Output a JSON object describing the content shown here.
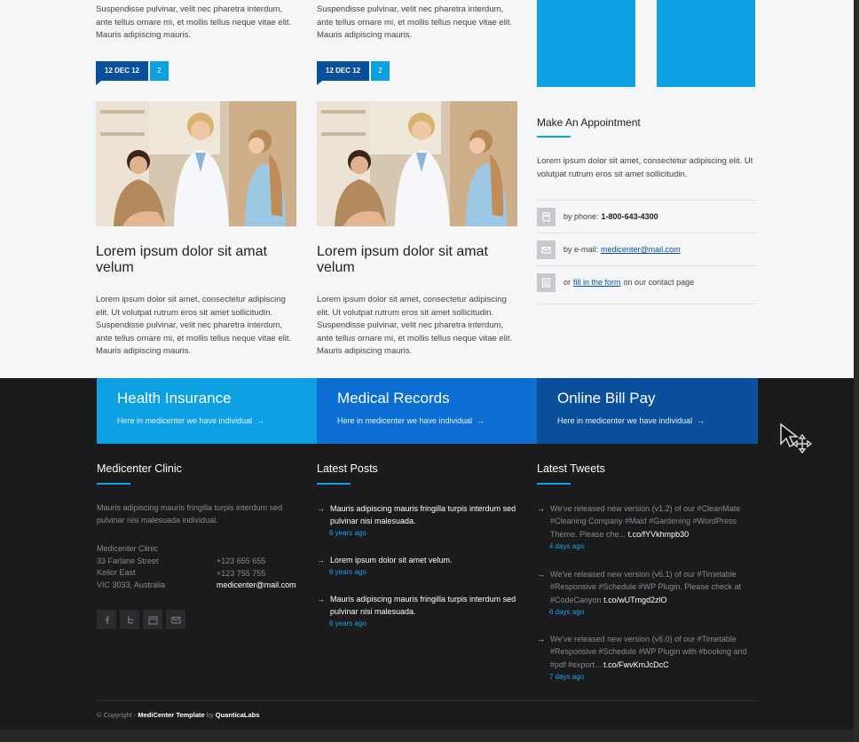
{
  "posts": [
    {
      "top_excerpt": "Suspendisse pulvinar, velit nec pharetra interdum, ante tellus ornare mi, et mollis tellus neque vitae elit. Mauris adipiscing mauris.",
      "date": "12 DEC 12",
      "comments": "2",
      "title": "Lorem ipsum dolor sit amat velum",
      "excerpt": "Lorem ipsum dolor sit amet, consectetur adipiscing elit. Ut volutpat rutrum eros sit amet sollicitudin. Suspendisse pulvinar, velit nec pharetra interdum, ante tellus ornare mi, et mollis tellus neque vitae elit. Mauris adipiscing mauris."
    },
    {
      "top_excerpt": "Suspendisse pulvinar, velit nec pharetra interdum, ante tellus ornare mi, et mollis tellus neque vitae elit. Mauris adipiscing mauris.",
      "date": "12 DEC 12",
      "comments": "2",
      "title": "Lorem ipsum dolor sit amat velum",
      "excerpt": "Lorem ipsum dolor sit amet, consectetur adipiscing elit. Ut volutpat rutrum eros sit amet sollicitudin. Suspendisse pulvinar, velit nec pharetra interdum, ante tellus ornare mi, et mollis tellus neque vitae elit. Mauris adipiscing mauris."
    }
  ],
  "appointment": {
    "title": "Make An Appointment",
    "description": "Lorem ipsum dolor sit amet, consectetur adipiscing elit. Ut volutpat rutrum eros sit amet sollicitudin.",
    "phone_prefix": "by phone:",
    "phone": "1-800-643-4300",
    "email_prefix": "by e-mail:",
    "email": "medicenter@mail.com",
    "form_prefix": "or",
    "form_link": "fill in the form",
    "form_suffix": "on our contact page"
  },
  "features": [
    {
      "title": "Health Insurance",
      "sub": "Here in medicenter we have individual",
      "arrow": "→"
    },
    {
      "title": "Medical Records",
      "sub": "Here in medicenter we have individual",
      "arrow": "→"
    },
    {
      "title": "Online Bill Pay",
      "sub": "Here in medicenter we have individual",
      "arrow": "→"
    }
  ],
  "footer": {
    "clinic": {
      "heading": "Medicenter Clinic",
      "about": "Mauris adipiscing mauris fringilla turpis interdum sed pulvinar nisi malesuada individual.",
      "address": [
        "Medicenter Clinic",
        "33 Farlane Street",
        "Keilor East",
        "VIC 3033, Australia"
      ],
      "phone1": "+123 655 655",
      "phone2": "+123 755 755",
      "email": "medicenter@mail.com"
    },
    "posts_heading": "Latest Posts",
    "latest_posts": [
      {
        "text": "Mauris adipiscing mauris fringilla turpis interdum sed pulvinar nisi malesuada.",
        "ago": "6 years ago"
      },
      {
        "text": "Lorem ipsum dolor sit amet velum.",
        "ago": "6 years ago"
      },
      {
        "text": "Mauris adipiscing mauris fringilla turpis interdum sed pulvinar nisi malesuada.",
        "ago": "6 years ago"
      }
    ],
    "tweets_heading": "Latest Tweets",
    "tweets": [
      {
        "text": "We've released new version (v1.2) of our #CleanMate #Cleaning Company #Maid #Gardening #WordPress Theme. Please che...",
        "link": "t.co/fYVkhmpb30",
        "ago": "4 days ago"
      },
      {
        "text": "We've released new version (v6.1) of our #Timetable #Responsive #Schedule #WP Plugin. Please check at #CodeCanyon",
        "link": "t.co/wUTmgd2zlO",
        "ago": "6 days ago"
      },
      {
        "text": "We've released new version (v6.0) of our #Timetable #Responsive #Schedule #WP Plugin with #booking and #pdf #export...",
        "link": "t.co/FwvKmJcDcC",
        "ago": "7 days ago"
      }
    ],
    "copyright_prefix": "© Copyright -",
    "copyright_brand": "MediCenter Template",
    "copyright_by": "by",
    "copyright_author": "QuanticaLabs"
  },
  "icons": [
    "phone-icon",
    "mail-icon",
    "form-icon",
    "facebook-icon",
    "twitter-icon",
    "calendar-icon",
    "envelope-icon",
    "move-cursor-icon"
  ],
  "colors": {
    "light_blue": "#0da0e2",
    "mid_blue": "#0c6ed2",
    "dark_blue": "#0a4f9c",
    "footer_bg": "#1b1b1d",
    "page_bg": "#f5f6f8"
  }
}
